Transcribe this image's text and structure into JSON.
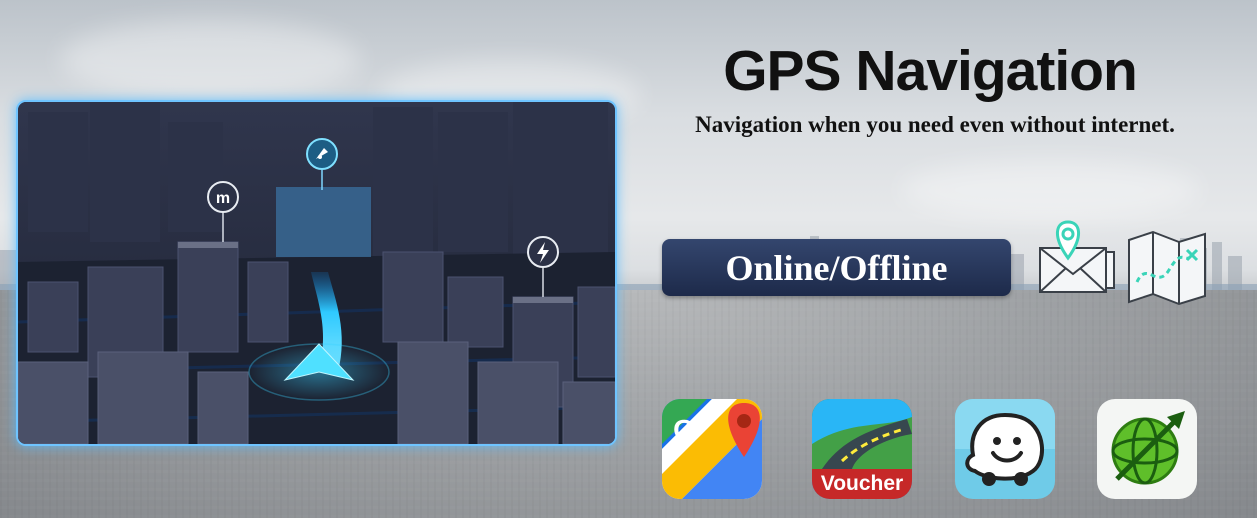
{
  "header": {
    "title": "GPS Navigation",
    "subtitle": "Navigation when you need even without internet."
  },
  "badge": {
    "label": "Online/Offline"
  },
  "apps": [
    {
      "name": "google-maps",
      "label": ""
    },
    {
      "name": "sygic",
      "label": "Voucher"
    },
    {
      "name": "waze",
      "label": ""
    },
    {
      "name": "navitel",
      "label": ""
    }
  ],
  "colors": {
    "badge_bg": "#24335a",
    "map_glow": "#6fc4ff",
    "route": "#33d4ff"
  },
  "map_pins": [
    "mcdonalds-pin-icon",
    "rocket-pin-icon",
    "charging-pin-icon"
  ]
}
